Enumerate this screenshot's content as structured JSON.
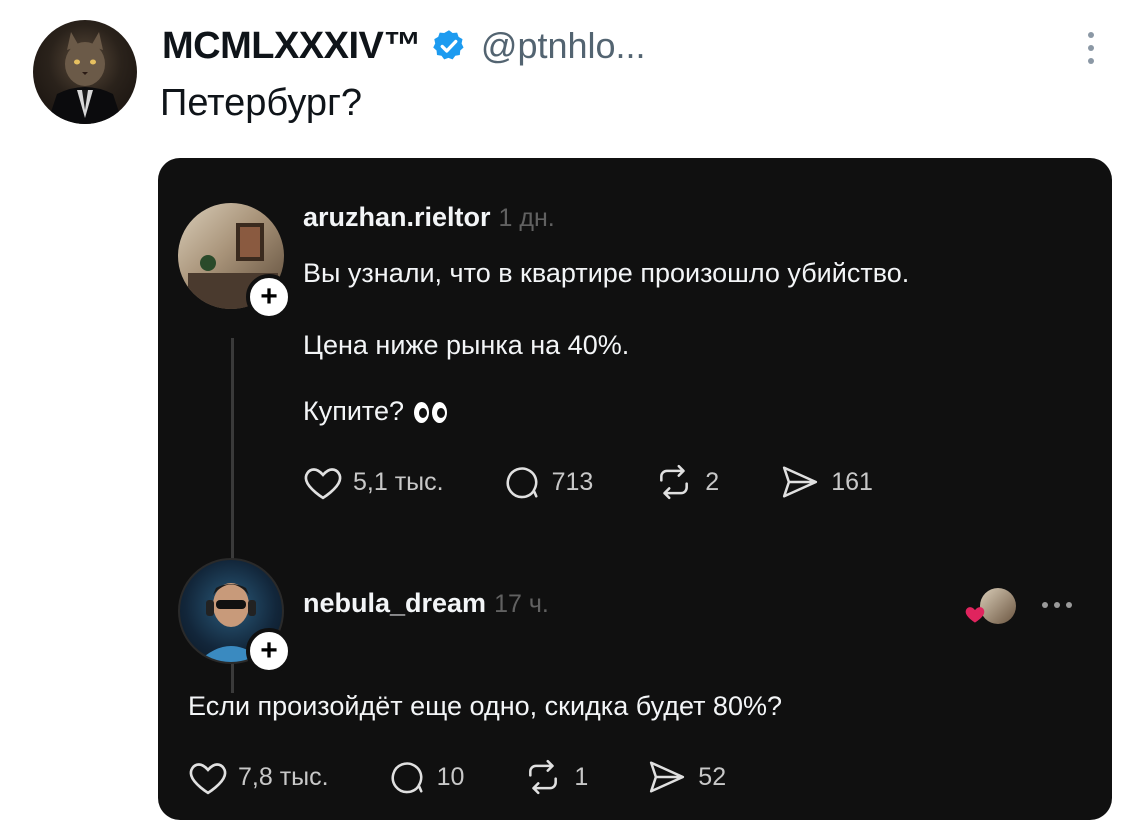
{
  "tweet": {
    "display_name": "MCMLXXXIV™",
    "handle": "@ptnhlo...",
    "text": "Петербург?",
    "avatar_icon": "cat-in-suit-avatar",
    "verified_icon": "verified-badge-icon",
    "verified_color": "#1d9bf0"
  },
  "screenshot": {
    "post": {
      "username": "aruzhan.rieltor",
      "time": "1 дн.",
      "lines": [
        "Вы узнали, что в квартире произошло убийство.",
        "Цена ниже рынка на 40%.",
        "Купите?"
      ],
      "emoji_icon": "eyes-emoji",
      "likes": "5,1 тыс.",
      "comments": "713",
      "reposts": "2",
      "shares": "161"
    },
    "reply": {
      "username": "nebula_dream",
      "time": "17 ч.",
      "text": "Если произойдёт еще одно, скидка будет 80%?",
      "likes": "7,8 тыс.",
      "comments": "10",
      "reposts": "1",
      "shares": "52"
    },
    "plus_symbol": "+"
  }
}
